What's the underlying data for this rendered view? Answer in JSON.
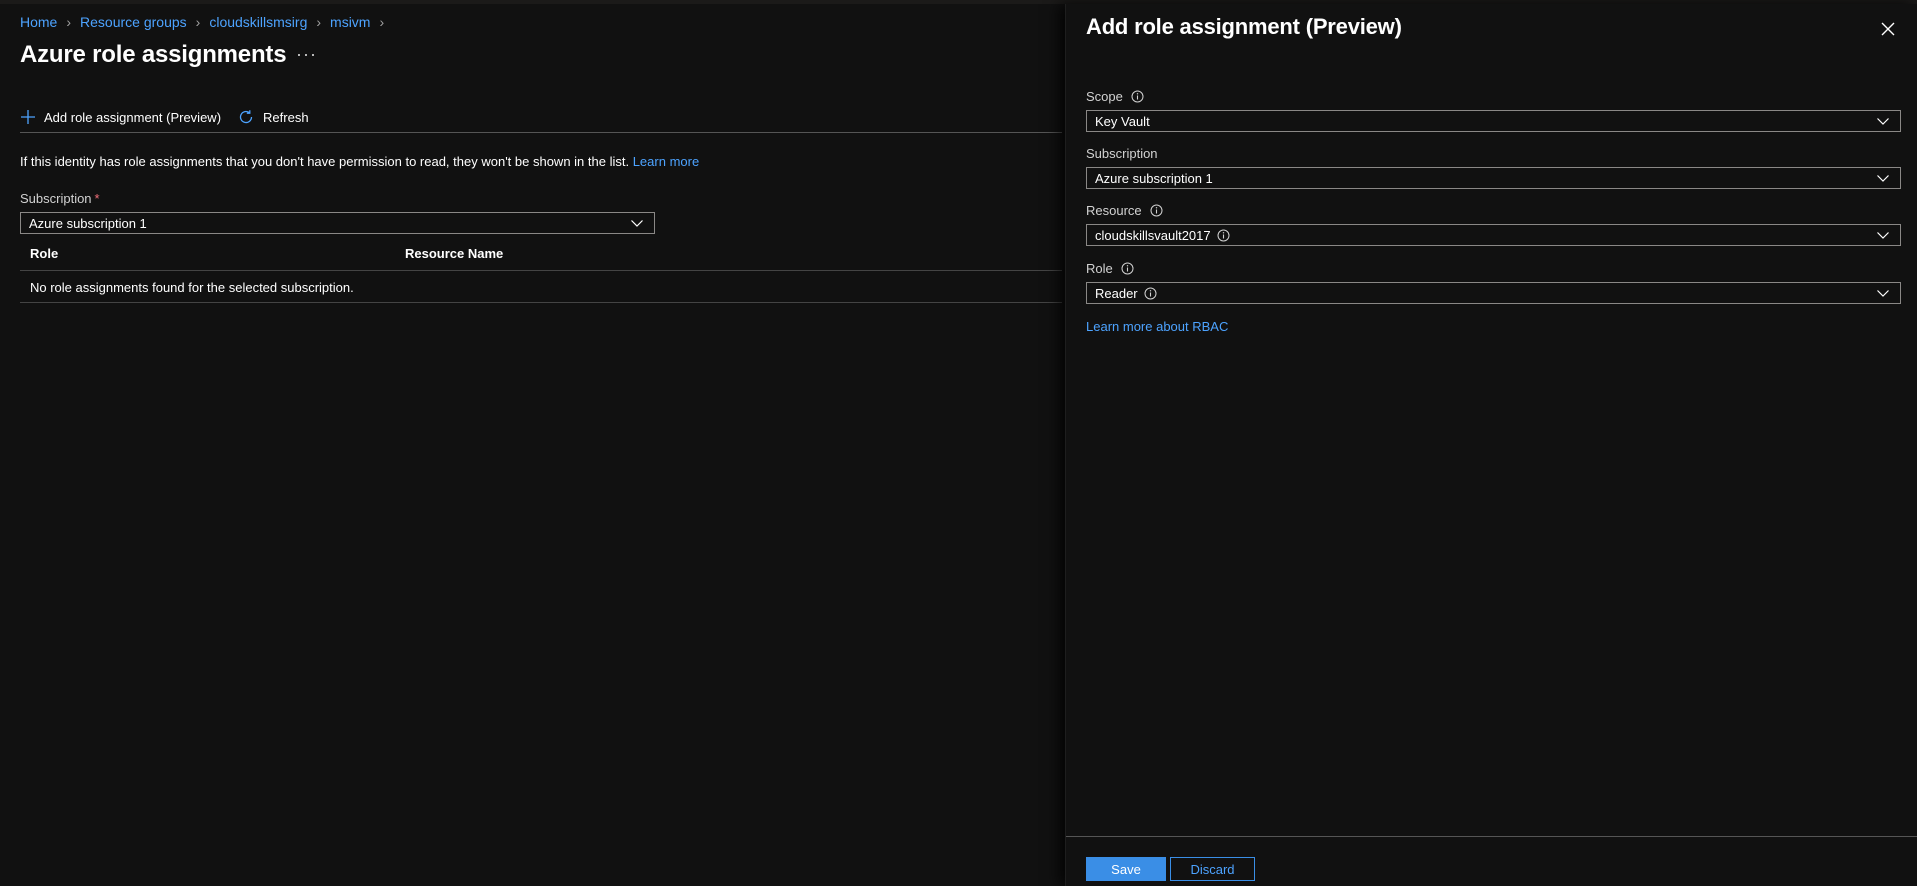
{
  "breadcrumb": [
    {
      "label": "Home"
    },
    {
      "label": "Resource groups"
    },
    {
      "label": "cloudskillsmsirg"
    },
    {
      "label": "msivm"
    }
  ],
  "page": {
    "title": "Azure role assignments",
    "more_label": "···"
  },
  "commands": {
    "add_label": "Add role assignment (Preview)",
    "refresh_label": "Refresh"
  },
  "info": {
    "text": "If this identity has role assignments that you don't have permission to read, they won't be shown in the list.",
    "learn_more": "Learn more"
  },
  "subscription_filter": {
    "label": "Subscription",
    "required_mark": "*",
    "value": "Azure subscription 1"
  },
  "table": {
    "columns": [
      "Role",
      "Resource Name"
    ],
    "empty_message": "No role assignments found for the selected subscription."
  },
  "panel": {
    "title": "Add role assignment (Preview)",
    "fields": {
      "scope": {
        "label": "Scope",
        "value": "Key Vault"
      },
      "subscription": {
        "label": "Subscription",
        "value": "Azure subscription 1"
      },
      "resource": {
        "label": "Resource",
        "value": "cloudskillsvault2017"
      },
      "role": {
        "label": "Role",
        "value": "Reader"
      }
    },
    "rbac_link": "Learn more about RBAC",
    "save_label": "Save",
    "discard_label": "Discard"
  },
  "colors": {
    "background": "#111111",
    "link": "#4da3ff",
    "primary_button": "#3a8ee6",
    "required": "#f1707b"
  }
}
